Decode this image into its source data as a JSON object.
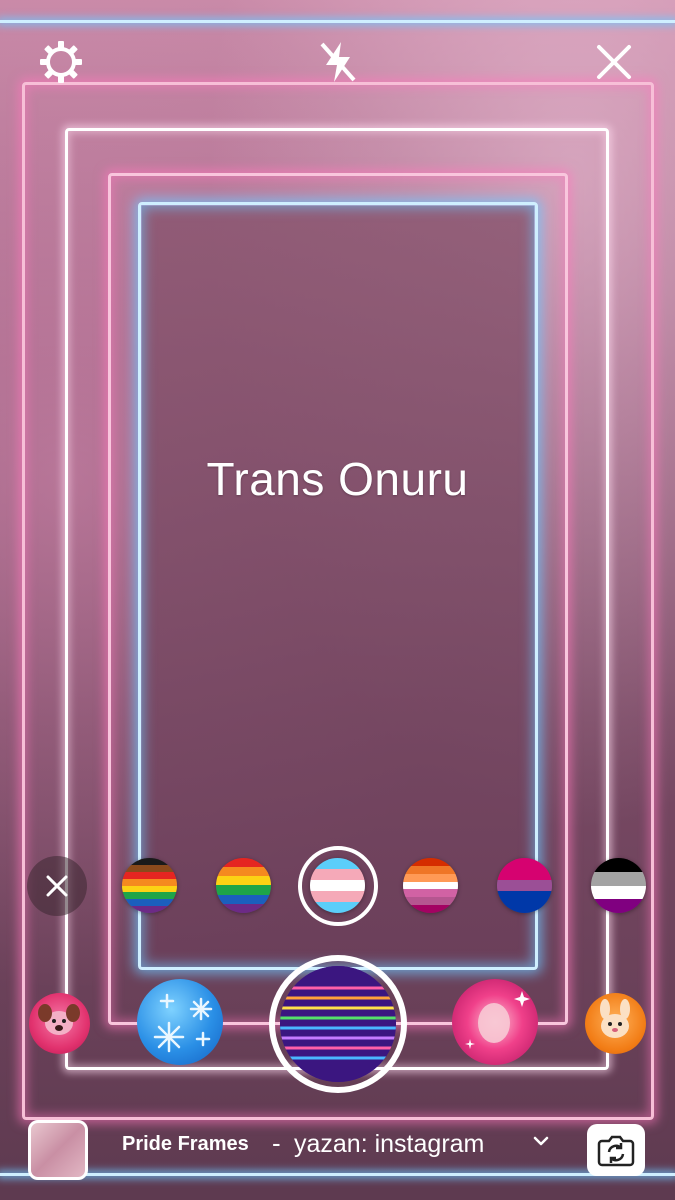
{
  "header": {
    "settings_icon": "gear-icon",
    "flash_icon": "flash-off-icon",
    "close_icon": "close-icon"
  },
  "overlay": {
    "title": "Trans Onuru"
  },
  "flags": [
    {
      "name": "flag-gilbert-baker",
      "stripes": [
        "#1a1a1a",
        "#8a4a1c",
        "#e52521",
        "#f58a1f",
        "#fcd214",
        "#1ea548",
        "#1b5fbd",
        "#6c2a86"
      ]
    },
    {
      "name": "flag-rainbow",
      "stripes": [
        "#e52521",
        "#f58a1f",
        "#fcd214",
        "#1ea548",
        "#1b5fbd",
        "#6c2a86"
      ]
    },
    {
      "name": "flag-transgender",
      "stripes": [
        "#5bcefa",
        "#f5a9b8",
        "#ffffff",
        "#f5a9b8",
        "#5bcefa"
      ],
      "selected": true
    },
    {
      "name": "flag-lesbian",
      "stripes": [
        "#d52d00",
        "#ef7627",
        "#ff9a56",
        "#ffffff",
        "#d162a4",
        "#b55690",
        "#a30262"
      ]
    },
    {
      "name": "flag-bisexual",
      "stripes": [
        "#d60270",
        "#d60270",
        "#9b4f96",
        "#0038a8",
        "#0038a8"
      ]
    },
    {
      "name": "flag-asexual",
      "stripes": [
        "#000000",
        "#a3a3a3",
        "#ffffff",
        "#800080"
      ]
    }
  ],
  "effects": {
    "left_far": "dog-face-effect",
    "left": "snowflake-effect",
    "current": "pride-frames-effect",
    "right": "glow-bubble-effect",
    "right_far": "bunny-face-effect"
  },
  "footer": {
    "effect_name": "Pride Frames",
    "separator": "-",
    "author": "yazan: instagram",
    "chevron_icon": "chevron-down-icon",
    "gallery_icon": "gallery-thumbnail",
    "flip_icon": "camera-flip-icon"
  },
  "colors": {
    "neon_pink": "#f7bfd7",
    "neon_blue": "#cfefff",
    "background": "#7a4a65"
  }
}
